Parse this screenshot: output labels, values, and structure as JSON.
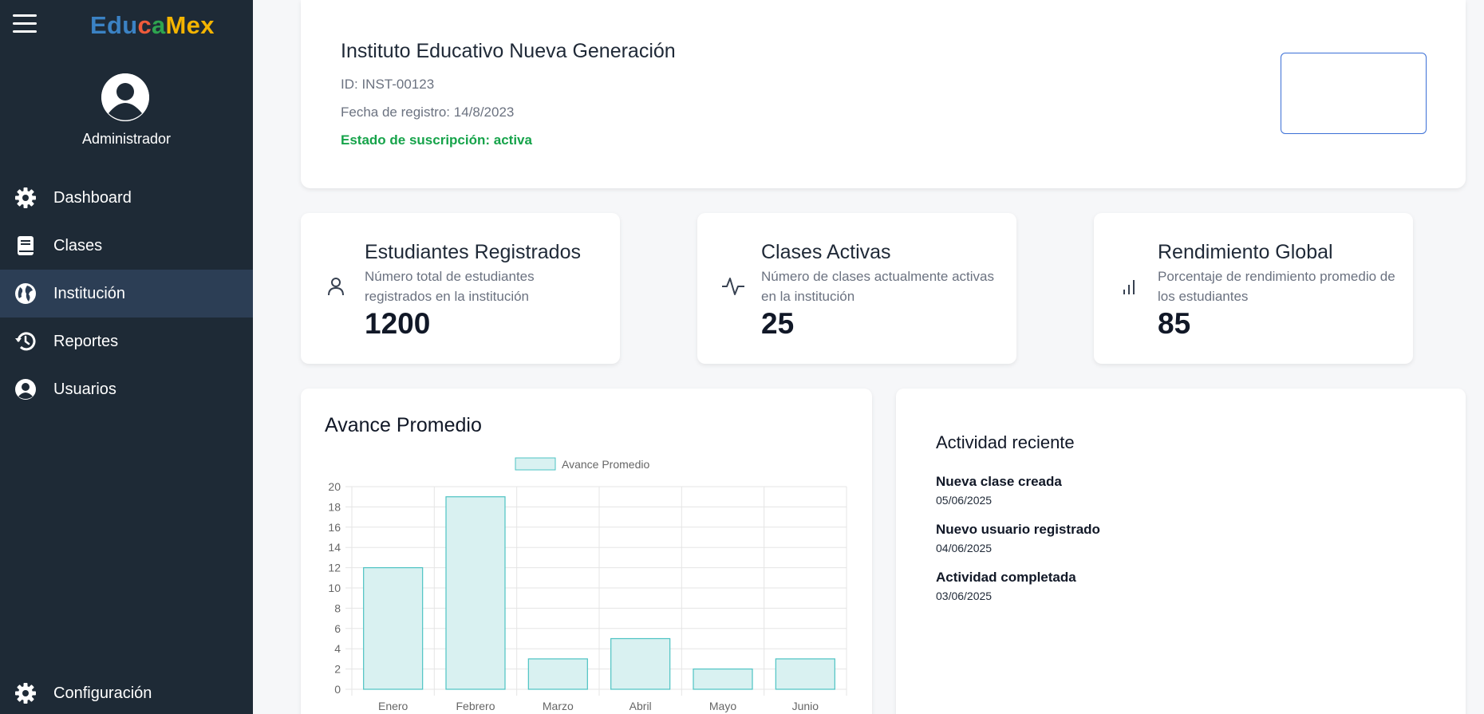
{
  "app": {
    "logo_parts": [
      "Edu",
      "c",
      "a",
      "Mex"
    ],
    "brand_colors": [
      "#3b82c4",
      "#ef5b3b",
      "#2ea44f",
      "#f4b400"
    ]
  },
  "sidebar": {
    "menu_icon": "hamburger-icon",
    "avatar_icon": "user-circle-icon",
    "role": "Administrador",
    "items": [
      {
        "label": "Dashboard",
        "icon": "gear-icon"
      },
      {
        "label": "Clases",
        "icon": "book-icon"
      },
      {
        "label": "Institución",
        "icon": "globe-icon",
        "active": true
      },
      {
        "label": "Reportes",
        "icon": "history-icon"
      },
      {
        "label": "Usuarios",
        "icon": "user-circle-icon"
      }
    ],
    "bottom_item": {
      "label": "Configuración",
      "icon": "gear-icon"
    }
  },
  "institution": {
    "name": "Instituto Educativo Nueva Generación",
    "id": "ID: INST-00123",
    "registered": "Fecha de registro: 14/8/2023",
    "status": "Estado de suscripción: activa"
  },
  "stats": [
    {
      "title": "Estudiantes Registrados",
      "desc": "Número total de estudiantes registrados en la institución",
      "value": "1200",
      "icon": "user-icon"
    },
    {
      "title": "Clases Activas",
      "desc": "Número de clases actualmente activas en la institución",
      "value": "25",
      "icon": "activity-icon"
    },
    {
      "title": "Rendimiento Global",
      "desc": "Porcentaje de rendimiento promedio de los estudiantes",
      "value": "85",
      "icon": "bar-chart-icon"
    }
  ],
  "chart_card": {
    "title": "Avance Promedio"
  },
  "chart_data": {
    "type": "bar",
    "categories": [
      "Enero",
      "Febrero",
      "Marzo",
      "Abril",
      "Mayo",
      "Junio"
    ],
    "series": [
      {
        "name": "Avance Promedio",
        "values": [
          12,
          19,
          3,
          5,
          2,
          3
        ]
      }
    ],
    "ylim": [
      0,
      20
    ],
    "yticks": [
      0,
      2,
      4,
      6,
      8,
      10,
      12,
      14,
      16,
      18,
      20
    ],
    "grid": true,
    "legend": "top-center",
    "bar_fill": "#d9f1f1",
    "bar_stroke": "#4dc3c3"
  },
  "activity": {
    "title": "Actividad reciente",
    "items": [
      {
        "title": "Nueva clase creada",
        "date": "05/06/2025"
      },
      {
        "title": "Nuevo usuario registrado",
        "date": "04/06/2025"
      },
      {
        "title": "Actividad completada",
        "date": "03/06/2025"
      }
    ]
  }
}
